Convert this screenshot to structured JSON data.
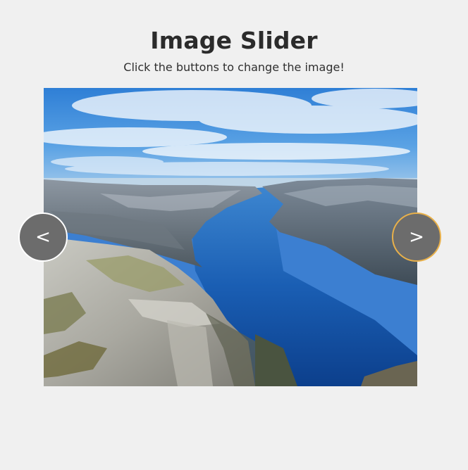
{
  "page": {
    "title": "Image Slider",
    "subtitle": "Click the buttons to change the image!"
  },
  "slider": {
    "prev_label": "<",
    "next_label": ">",
    "image_alt": "Fjord landscape viewed from a cliff top",
    "colors": {
      "button_bg": "#6c6c6c",
      "prev_border": "#ffffff",
      "next_border_focus": "#e8b04a"
    }
  }
}
